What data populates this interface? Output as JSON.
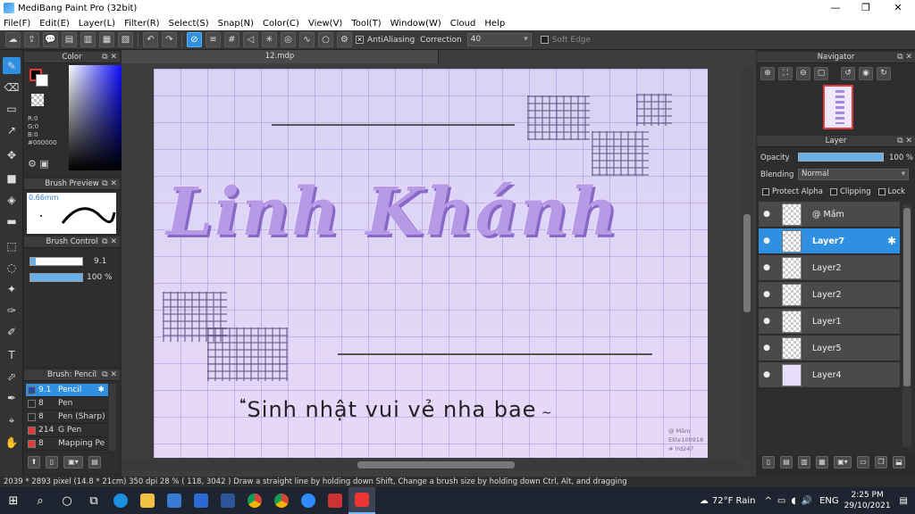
{
  "window": {
    "title": "MediBang Paint Pro (32bit)"
  },
  "menu": [
    "File(F)",
    "Edit(E)",
    "Layer(L)",
    "Filter(R)",
    "Select(S)",
    "Snap(N)",
    "Color(C)",
    "View(V)",
    "Tool(T)",
    "Window(W)",
    "Cloud",
    "Help"
  ],
  "toolbar": {
    "antialiasing_label": "AntiAliasing",
    "correction_label": "Correction",
    "correction_value": "40",
    "soft_edge_label": "Soft Edge"
  },
  "color_panel": {
    "title": "Color",
    "r": "R:0",
    "g": "G:0",
    "b": "B:0",
    "hex": "#000000",
    "colors": {
      "foreground": "#000000",
      "background": "#ffffff"
    }
  },
  "brush_preview": {
    "title": "Brush Preview",
    "size": "0.66mm"
  },
  "brush_control": {
    "title": "Brush Control",
    "size_value": "9.1",
    "opacity_value": "100 %"
  },
  "brush_list": {
    "title": "Brush: Pencil",
    "items": [
      {
        "size": "9.1",
        "name": "Pencil",
        "color": "#1e4fa0"
      },
      {
        "size": "8",
        "name": "Pen",
        "color": "#2a2a2a"
      },
      {
        "size": "8",
        "name": "Pen (Sharp)",
        "color": "#2a2a2a"
      },
      {
        "size": "214",
        "name": "G Pen",
        "color": "#e03a3a"
      },
      {
        "size": "8",
        "name": "Mapping Pe",
        "color": "#e03a3a"
      }
    ]
  },
  "document": {
    "tab": "12.mdp",
    "art_title": "Linh Khánh",
    "art_subtitle": "Sinh nhật vui vẻ nha bae",
    "credit_lines": [
      "@ Mầm",
      "Elite100918",
      "# lrd247"
    ]
  },
  "navigator": {
    "title": "Navigator"
  },
  "layer_panel": {
    "title": "Layer",
    "opacity_label": "Opacity",
    "opacity_value": "100 %",
    "blending_label": "Blending",
    "blending_value": "Normal",
    "protect_alpha": "Protect Alpha",
    "clipping": "Clipping",
    "lock": "Lock",
    "layers": [
      "@ Mầm",
      "Layer7",
      "Layer2",
      "Layer2",
      "Layer1",
      "Layer5",
      "Layer4"
    ],
    "active_index": 1
  },
  "status": {
    "text": "2039 * 2893 pixel  (14.8 * 21cm)  350 dpi  28 %  ( 118, 3042 )  Draw a straight line by holding down Shift, Change a brush size by holding down Ctrl, Alt, and dragging"
  },
  "taskbar": {
    "weather": "72°F  Rain",
    "lang": "ENG",
    "time": "2:25 PM",
    "date": "29/10/2021"
  },
  "colors": {
    "accent": "#2f8fe0"
  }
}
